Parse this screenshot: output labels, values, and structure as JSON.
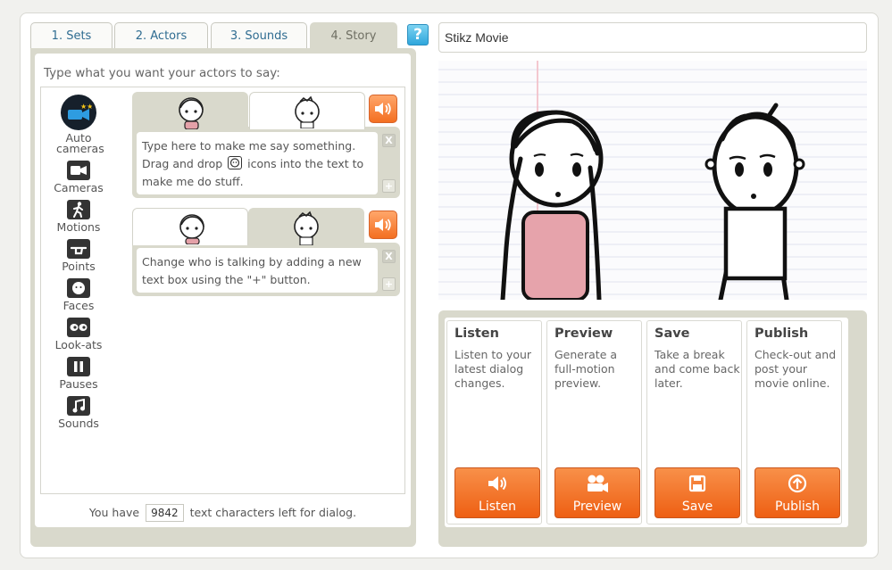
{
  "tabs": [
    {
      "label": "1. Sets"
    },
    {
      "label": "2. Actors"
    },
    {
      "label": "3. Sounds"
    },
    {
      "label": "4. Story"
    }
  ],
  "help_label": "?",
  "editor": {
    "prompt": "Type what you want your actors to say:",
    "tools": [
      {
        "label": "Auto cameras"
      },
      {
        "label": "Cameras"
      },
      {
        "label": "Motions"
      },
      {
        "label": "Points"
      },
      {
        "label": "Faces"
      },
      {
        "label": "Look-ats"
      },
      {
        "label": "Pauses"
      },
      {
        "label": "Sounds"
      }
    ],
    "dialogs": [
      {
        "text_before_icon": "Type here to make me say something. Drag and drop",
        "text_after_icon": " icons into the text to make me do stuff.",
        "active_actor": "girl"
      },
      {
        "text": "Change who is talking by adding a new text box using the \"+\" button.",
        "active_actor": "boy"
      }
    ],
    "remove_label": "X",
    "add_label": "+",
    "chars_prefix": "You have",
    "chars_count": "9842",
    "chars_suffix": "text characters left for dialog."
  },
  "movie_title": "Stikz Movie",
  "actions": [
    {
      "title": "Listen",
      "desc": "Listen to your latest dialog changes.",
      "button": "Listen",
      "icon": "speaker-icon"
    },
    {
      "title": "Preview",
      "desc": "Generate a full-motion preview.",
      "button": "Preview",
      "icon": "camera-icon"
    },
    {
      "title": "Save",
      "desc": "Take a break and come back later.",
      "button": "Save",
      "icon": "save-icon"
    },
    {
      "title": "Publish",
      "desc": "Check-out and post your movie online.",
      "button": "Publish",
      "icon": "publish-icon"
    }
  ],
  "colors": {
    "accent": "#f36f21",
    "panel": "#d9d9cc",
    "tab_text": "#2f6c91"
  }
}
